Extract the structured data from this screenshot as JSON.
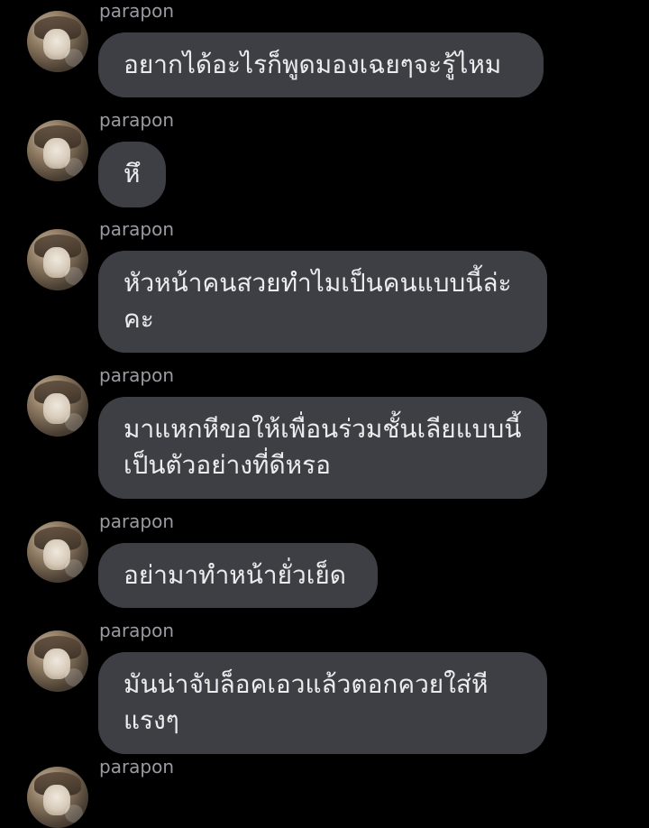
{
  "messages": [
    {
      "sender": "parapon",
      "text": "อยากได้อะไรก็พูดมองเฉยๆจะรู้ไหม"
    },
    {
      "sender": "parapon",
      "text": "หึ"
    },
    {
      "sender": "parapon",
      "text": "หัวหน้าคนสวยทำไมเป็นคนแบบนี้ล่ะคะ"
    },
    {
      "sender": "parapon",
      "text": "มาแหกหีขอให้เพื่อนร่วมชั้นเลียแบบนี้เป็นตัวอย่างที่ดีหรอ"
    },
    {
      "sender": "parapon",
      "text": "อย่ามาทำหน้ายั่วเย็ด"
    },
    {
      "sender": "parapon",
      "text": "มันน่าจับล็อคเอวแล้วตอกควยใส่หีแรงๆ"
    },
    {
      "sender": "parapon",
      "text": ""
    }
  ]
}
